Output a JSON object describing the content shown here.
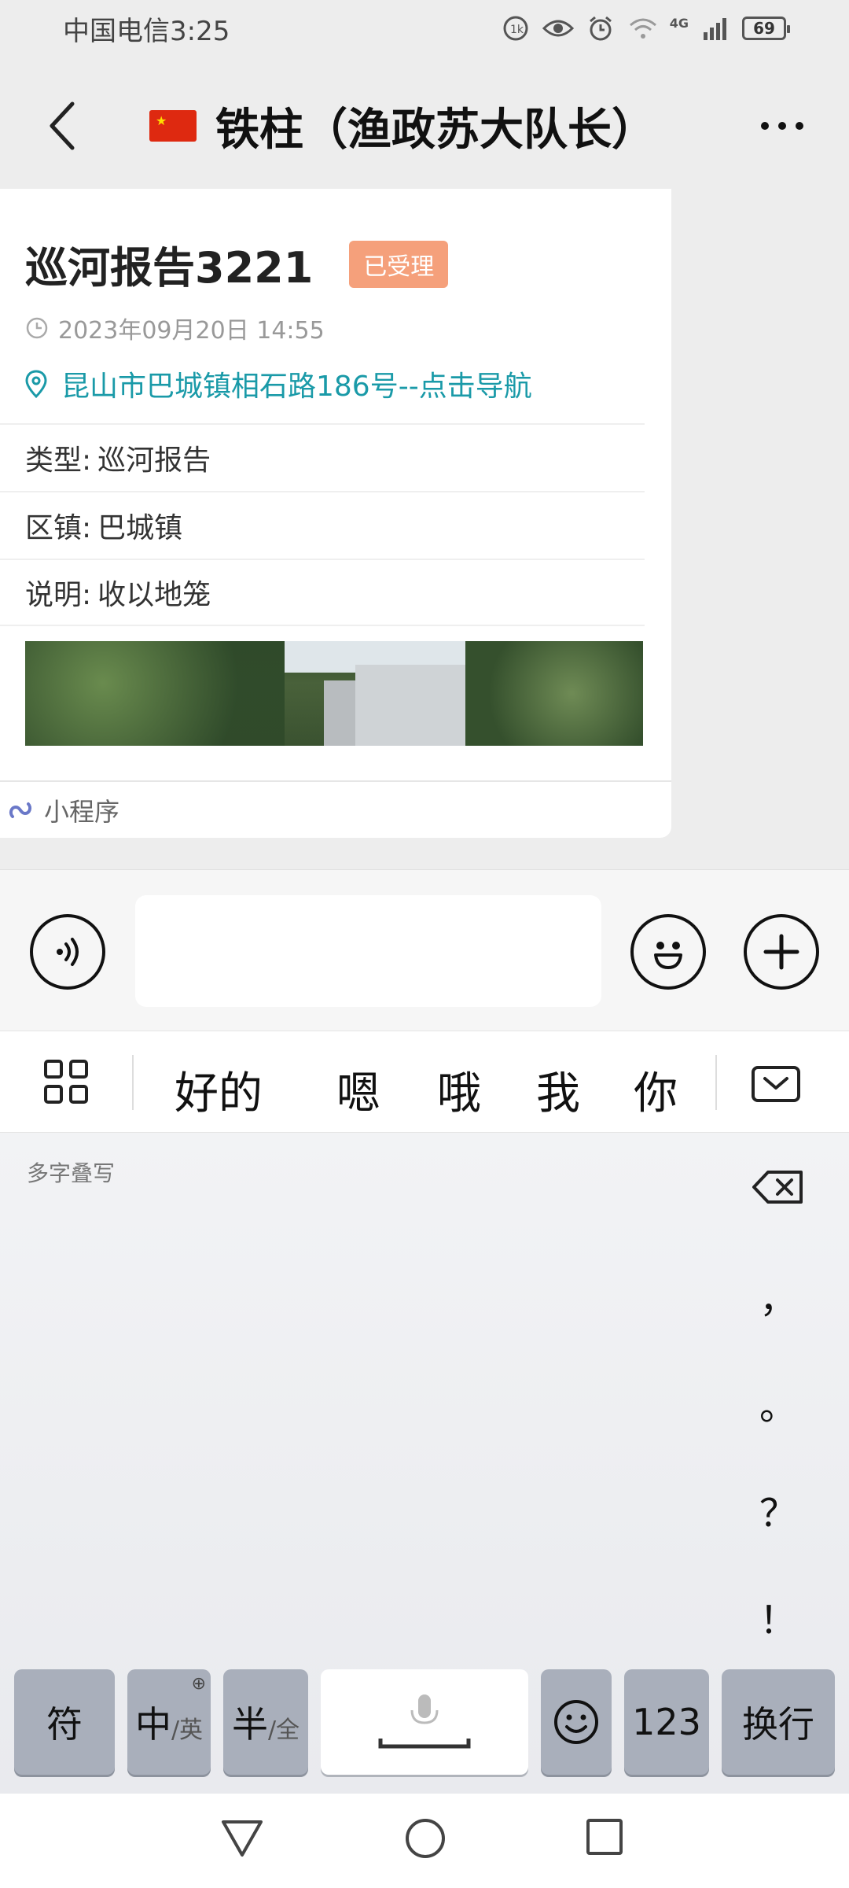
{
  "status_bar": {
    "carrier_time": "中国电信3:25",
    "network": "4G",
    "battery": "69"
  },
  "header": {
    "title": "铁柱（渔政苏大队长）"
  },
  "card": {
    "title": "巡河报告3221",
    "status": "已受理",
    "datetime": "2023年09月20日 14:55",
    "address": "昆山市巴城镇相石路186号--点击导航",
    "rows": [
      {
        "label": "类型:",
        "value": "巡河报告"
      },
      {
        "label": "区镇:",
        "value": "巴城镇"
      },
      {
        "label": "说明:",
        "value": "收以地笼"
      }
    ],
    "footer": "小程序"
  },
  "candidates": [
    "好的",
    "嗯",
    "哦",
    "我",
    "你"
  ],
  "keyboard": {
    "hint": "多字叠写",
    "punctuation": [
      "，",
      "。",
      "？",
      "！"
    ],
    "keys": {
      "symbol": "符",
      "lang_main": "中",
      "lang_sub": "/英",
      "width_main": "半",
      "width_sub": "/全",
      "num": "123",
      "enter": "换行"
    }
  },
  "colors": {
    "badge": "#f5a07b",
    "link": "#1a9aa8",
    "flag": "#de2910"
  }
}
